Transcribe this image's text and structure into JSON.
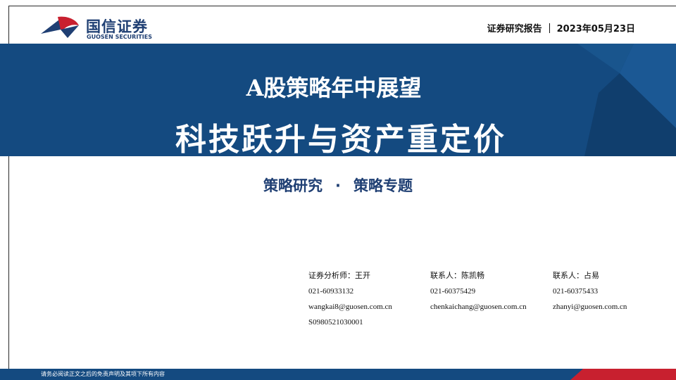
{
  "brand": {
    "name_cn": "国信证券",
    "name_en": "GUOSEN SECURITIES",
    "colors": {
      "blue": "#144a80",
      "red": "#c8202f"
    }
  },
  "header": {
    "report_type": "证券研究报告",
    "date": "2023年05月23日"
  },
  "banner": {
    "title_line1": "A股策略年中展望",
    "title_line2": "科技跃升与资产重定价"
  },
  "subtitle": {
    "category": "策略研究",
    "separator": "·",
    "topic": "策略专题"
  },
  "analysts": [
    {
      "role": "证券分析师：王开",
      "phone": "021-60933132",
      "email": "wangkai8@guosen.com.cn",
      "license": "S0980521030001"
    },
    {
      "role": "联系人：陈凯畅",
      "phone": "021-60375429",
      "email": "chenkaichang@guosen.com.cn"
    },
    {
      "role": "联系人：占易",
      "phone": "021-60375433",
      "email": "zhanyi@guosen.com.cn"
    }
  ],
  "footer": {
    "disclaimer": "请务必阅读正文之后的免责声明及其项下所有内容"
  }
}
